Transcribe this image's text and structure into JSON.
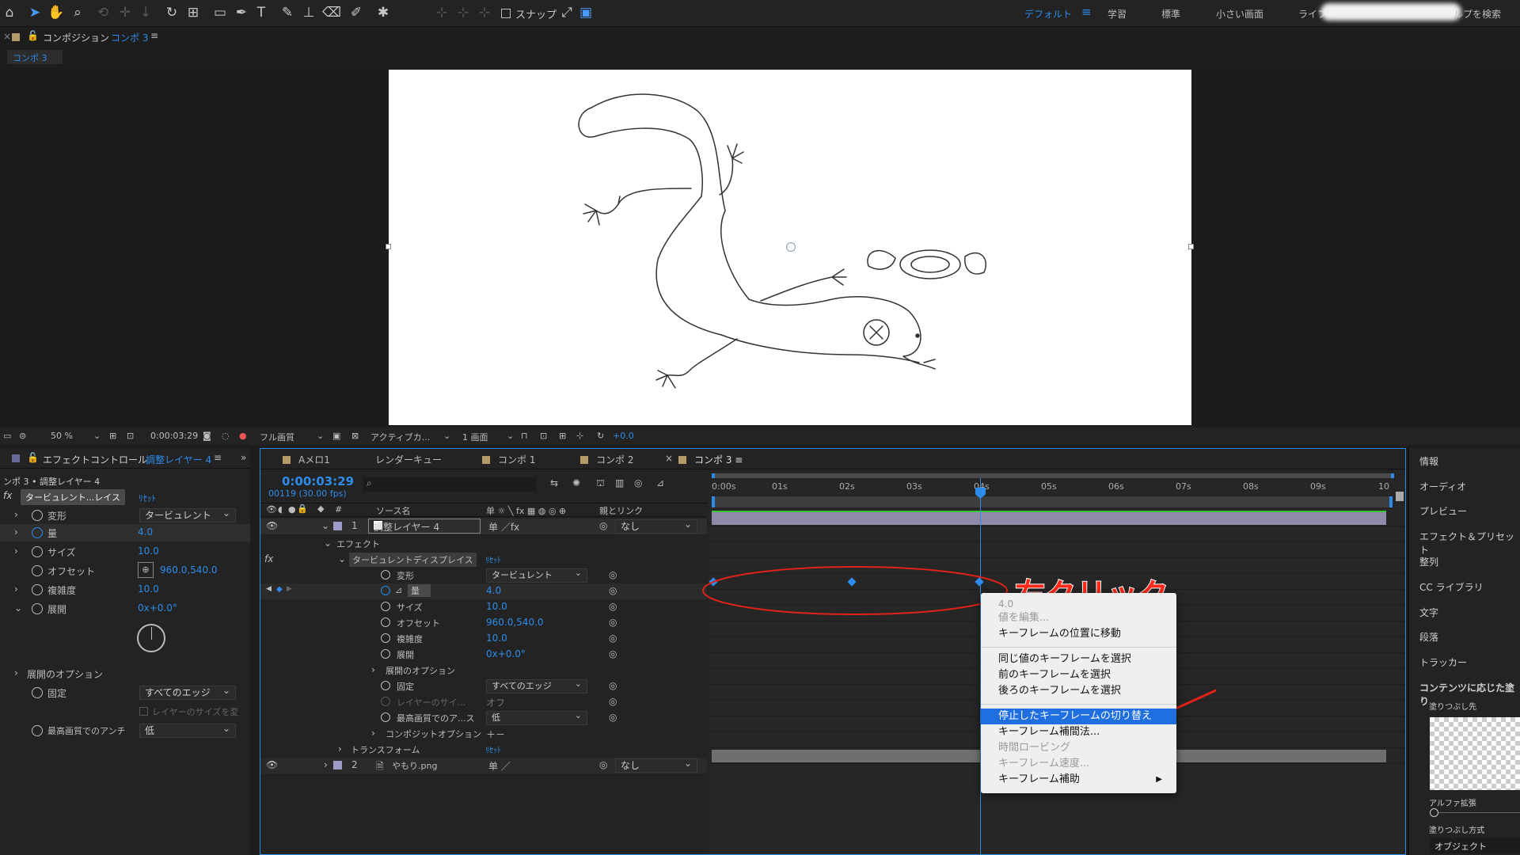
{
  "toolbar": {
    "snap_label": "スナップ",
    "workspaces": [
      "デフォルト",
      "学習",
      "標準",
      "小さい画面",
      "ライブ"
    ],
    "help_search": "ルプを検索"
  },
  "comp_panel": {
    "title_prefix": "コンポジション",
    "title_name": "コンポ 3",
    "tab": "コンポ 3"
  },
  "viewer_bar": {
    "zoom": "50 %",
    "timecode": "0:00:03:29",
    "quality": "フル画質",
    "camera": "アクティブカ...",
    "views": "1 画面",
    "exposure": "+0.0"
  },
  "effect_controls": {
    "title_prefix": "エフェクトコントロール",
    "title_layer": "調整レイヤー 4",
    "breadcrumb": "ンポ 3 • 調整レイヤー 4",
    "effect_name": "タービュレント...レイス",
    "reset": "ﾘｾｯﾄ",
    "params": [
      {
        "label": "変形",
        "value": "タービュレント"
      },
      {
        "label": "量",
        "value": "4.0"
      },
      {
        "label": "サイズ",
        "value": "10.0"
      },
      {
        "label": "オフセット",
        "value": "960.0,540.0"
      },
      {
        "label": "複雑度",
        "value": "10.0"
      },
      {
        "label": "展開",
        "value": "0x+0.0°"
      },
      {
        "label": "展開のオプション",
        "value": ""
      },
      {
        "label": "固定",
        "value": "すべてのエッジ"
      },
      {
        "label": "レイヤーのサイズを変",
        "value": ""
      },
      {
        "label": "最高画質でのアンチ",
        "value": "低"
      }
    ]
  },
  "timeline": {
    "tabs": [
      "Aメロ1",
      "レンダーキュー",
      "コンポ 1",
      "コンポ 2",
      "コンポ 3"
    ],
    "timecode": "0:00:03:29",
    "fps": "00119 (30.00 fps)",
    "search_placeholder": "",
    "col_source": "ソース名",
    "col_parent": "親とリンク",
    "rulers": [
      "0:00s",
      "01s",
      "02s",
      "03s",
      "04s",
      "05s",
      "06s",
      "07s",
      "08s",
      "09s",
      "10"
    ],
    "rows": [
      {
        "num": "1",
        "name": "調整レイヤー 4",
        "parent": "なし"
      },
      {
        "label": "エフェクト"
      },
      {
        "label": "タービュレントディスプレイス",
        "value": "ﾘｾｯﾄ"
      },
      {
        "label": "変形",
        "value": "タービュレント"
      },
      {
        "label": "量",
        "value": "4.0"
      },
      {
        "label": "サイズ",
        "value": "10.0"
      },
      {
        "label": "オフセット",
        "value": "960.0,540.0"
      },
      {
        "label": "複雑度",
        "value": "10.0"
      },
      {
        "label": "展開",
        "value": "0x+0.0°"
      },
      {
        "label": "展開のオプション"
      },
      {
        "label": "固定",
        "value": "すべてのエッジ"
      },
      {
        "label": "レイヤーのサイ...",
        "value": "オフ"
      },
      {
        "label": "最高画質でのア...ス",
        "value": "低"
      },
      {
        "label": "コンポジットオプション",
        "value": "＋－"
      },
      {
        "label": "トランスフォーム",
        "value": "ﾘｾｯﾄ"
      },
      {
        "num": "2",
        "name": "やもり.png",
        "parent": "なし"
      }
    ]
  },
  "context_menu": {
    "items": [
      {
        "label": "4.0",
        "disabled": true
      },
      {
        "label": "値を編集...",
        "disabled": true
      },
      {
        "label": "キーフレームの位置に移動",
        "disabled": false
      },
      {
        "label": "同じ値のキーフレームを選択",
        "disabled": false
      },
      {
        "label": "前のキーフレームを選択",
        "disabled": false
      },
      {
        "label": "後ろのキーフレームを選択",
        "disabled": false
      },
      {
        "label": "停止したキーフレームの切り替え",
        "disabled": false,
        "highlighted": true
      },
      {
        "label": "キーフレーム補間法...",
        "disabled": false
      },
      {
        "label": "時間ロービング",
        "disabled": true
      },
      {
        "label": "キーフレーム速度...",
        "disabled": true
      },
      {
        "label": "キーフレーム補助",
        "disabled": false
      }
    ]
  },
  "annotation": {
    "label": "右クリック",
    "color": "#ff2a1a"
  },
  "right_panel": {
    "items": [
      "情報",
      "オーディオ",
      "プレビュー",
      "エフェクト＆プリセット",
      "整列",
      "CC ライブラリ",
      "文字",
      "段落",
      "トラッカー",
      "コンテンツに応じた塗り"
    ],
    "fill_label": "塗りつぶし先",
    "alpha_label": "アルファ拡張",
    "method_label": "塗りつぶし方式",
    "method_value": "オブジェクト"
  },
  "colors": {
    "accent": "#2d8ceb",
    "highlight": "#1f6fe0"
  }
}
